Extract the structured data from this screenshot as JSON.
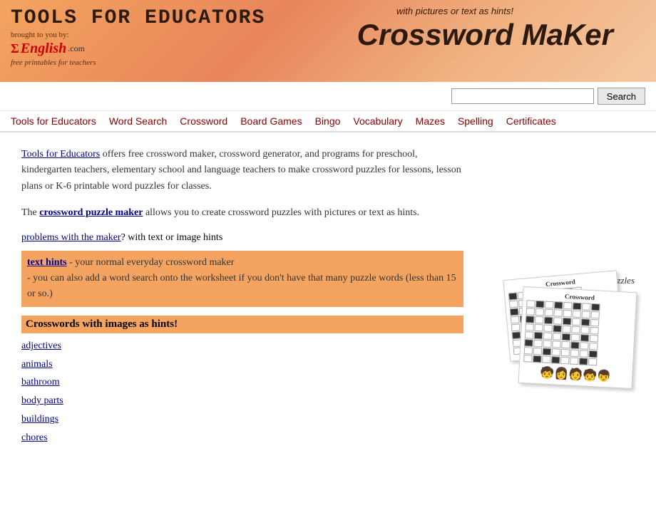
{
  "header": {
    "title": "Tools for Educators",
    "brought_by": "brought to you by:",
    "logo_sigma": "Σ",
    "logo_english": "English",
    "logo_com": ".com",
    "free_text": "free printables for teachers",
    "subtitle": "with pictures or text as hints!",
    "maker_title": "Crossword MaKer"
  },
  "search": {
    "placeholder": "",
    "button_label": "Search"
  },
  "nav": {
    "items": [
      {
        "label": "Tools for Educators",
        "href": "#"
      },
      {
        "label": "Word Search",
        "href": "#"
      },
      {
        "label": "Crossword",
        "href": "#"
      },
      {
        "label": "Board Games",
        "href": "#"
      },
      {
        "label": "Bingo",
        "href": "#"
      },
      {
        "label": "Vocabulary",
        "href": "#"
      },
      {
        "label": "Mazes",
        "href": "#"
      },
      {
        "label": "Spelling",
        "href": "#"
      },
      {
        "label": "Certificates",
        "href": "#"
      }
    ]
  },
  "main": {
    "intro": {
      "link_text": "Tools for Educators",
      "text1": " offers free crossword maker, crossword generator, and programs for preschool, kindergarten teachers, elementary school and language teachers to make crossword puzzles for lessons, lesson plans or K-6 printable word puzzles for classes.",
      "text2": "The ",
      "crossword_link": "crossword puzzle maker",
      "text3": " allows you to create crossword puzzles with pictures or text as hints."
    },
    "problems_link": "problems with the maker",
    "problems_text": "? with text or image hints",
    "text_hints_link": "text hints",
    "text_hints_desc": " - your normal everyday crossword maker",
    "text_hints_extra": "- you can also add a word search onto the worksheet if you don't have that many puzzle words (less than 15 or so.)",
    "crosswords_images_title": "Crosswords with images as hints!",
    "image_links": [
      {
        "label": "adjectives",
        "href": "#"
      },
      {
        "label": "animals",
        "href": "#"
      },
      {
        "label": "bathroom",
        "href": "#"
      },
      {
        "label": "body parts",
        "href": "#"
      },
      {
        "label": "buildings",
        "href": "#"
      },
      {
        "label": "chores",
        "href": "#"
      }
    ],
    "make_crossword_caption": "make crossword puzzles"
  }
}
